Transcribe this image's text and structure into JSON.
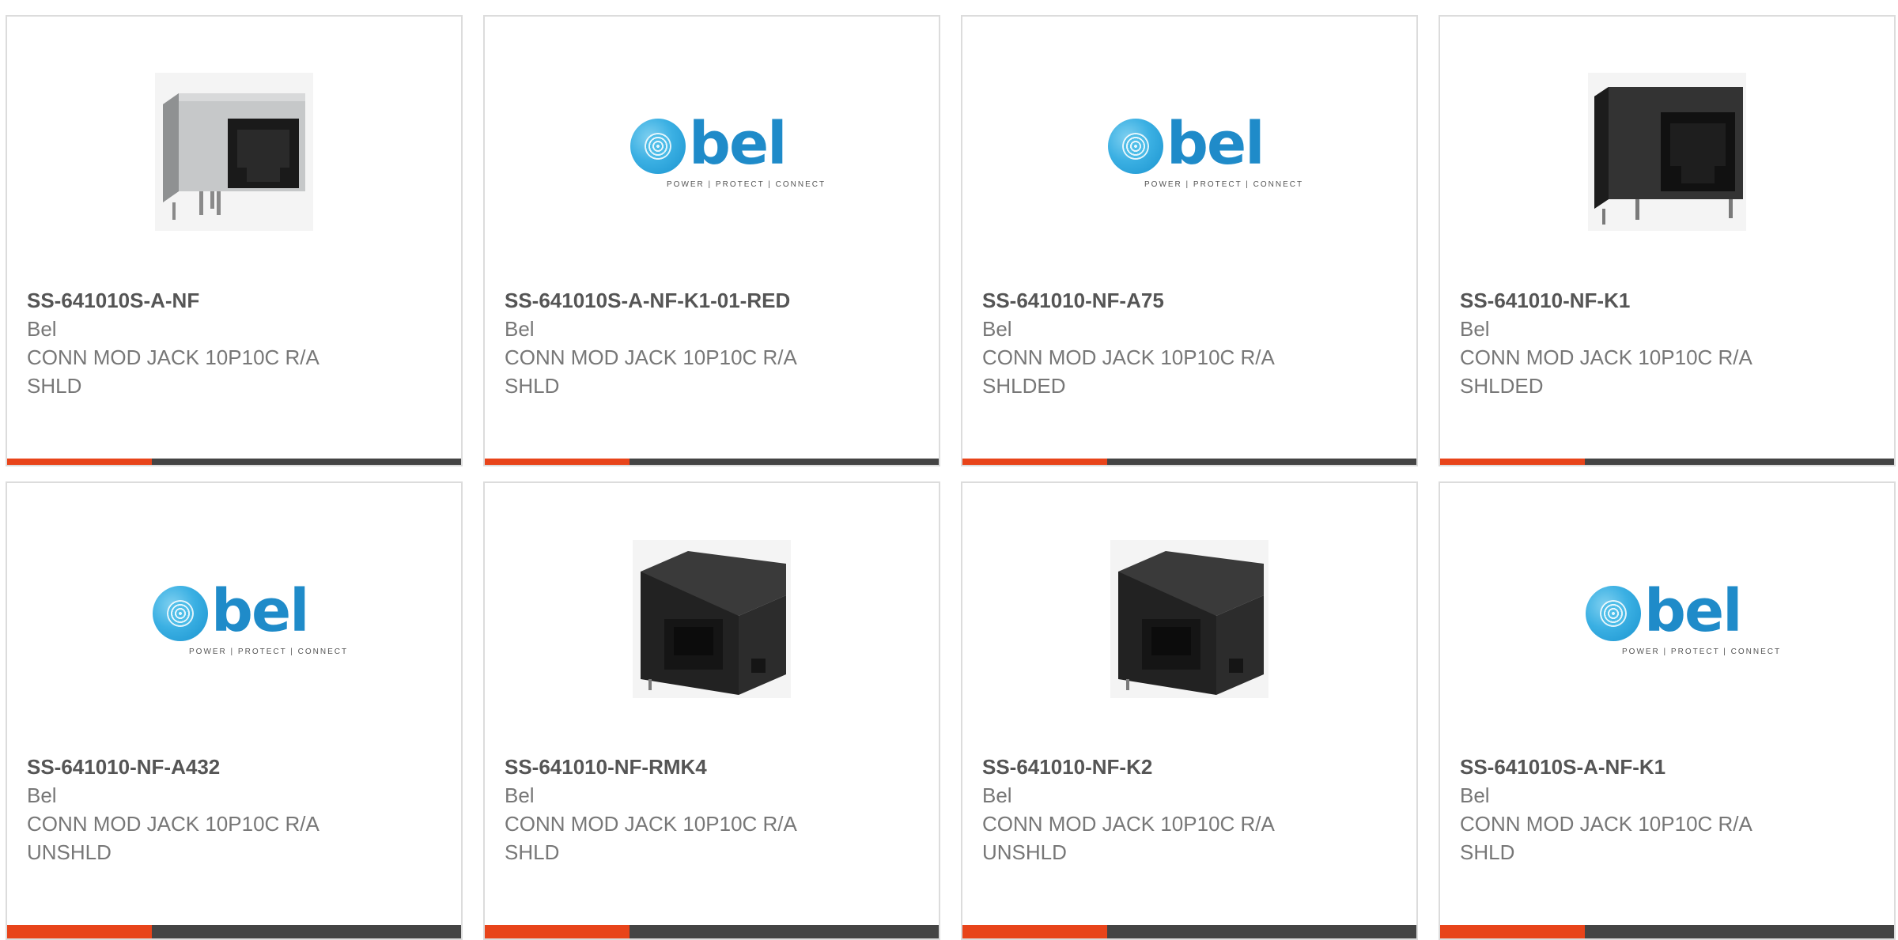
{
  "cards": [
    {
      "part_number": "SS-641010S-A-NF",
      "manufacturer": "Bel",
      "description": "CONN MOD JACK 10P10C R/A SHLD",
      "image": "jack-metal-shielded"
    },
    {
      "part_number": "SS-641010S-A-NF-K1-01-RED",
      "manufacturer": "Bel",
      "description": "CONN MOD JACK 10P10C R/A SHLD",
      "image": "bel-logo"
    },
    {
      "part_number": "SS-641010-NF-A75",
      "manufacturer": "Bel",
      "description": "CONN MOD JACK 10P10C R/A SHLDED",
      "image": "bel-logo"
    },
    {
      "part_number": "SS-641010-NF-K1",
      "manufacturer": "Bel",
      "description": "CONN MOD JACK 10P10C R/A SHLDED",
      "image": "jack-black-front"
    },
    {
      "part_number": "SS-641010-NF-A432",
      "manufacturer": "Bel",
      "description": "CONN MOD JACK 10P10C R/A UNSHLD",
      "image": "bel-logo"
    },
    {
      "part_number": "SS-641010-NF-RMK4",
      "manufacturer": "Bel",
      "description": "CONN MOD JACK 10P10C R/A SHLD",
      "image": "jack-black-angled"
    },
    {
      "part_number": "SS-641010-NF-K2",
      "manufacturer": "Bel",
      "description": "CONN MOD JACK 10P10C R/A UNSHLD",
      "image": "jack-black-angled"
    },
    {
      "part_number": "SS-641010S-A-NF-K1",
      "manufacturer": "Bel",
      "description": "CONN MOD JACK 10P10C R/A SHLD",
      "image": "bel-logo"
    }
  ],
  "logo": {
    "word": "bel",
    "tagline": "POWER | PROTECT | CONNECT"
  },
  "colors": {
    "accent": "#e8441a",
    "bar": "#444444",
    "text_bold": "#555555",
    "text": "#777777",
    "logo_blue": "#1f8bc9"
  }
}
